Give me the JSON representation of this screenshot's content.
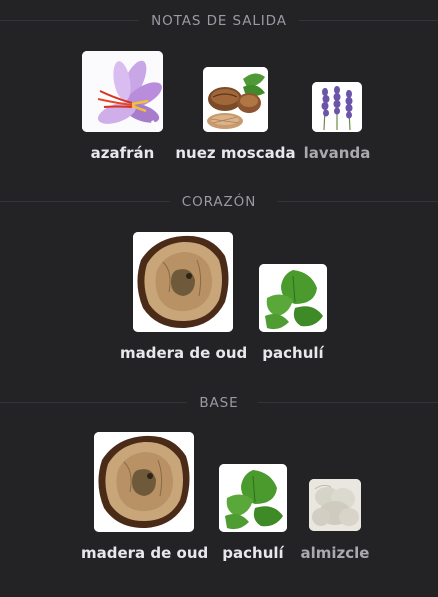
{
  "sections": [
    {
      "title": "NOTAS DE SALIDA",
      "notes": [
        {
          "label": "azafrán",
          "icon": "saffron-flower-icon",
          "emphasis": "high"
        },
        {
          "label": "nuez moscada",
          "icon": "nutmeg-icon",
          "emphasis": "medium"
        },
        {
          "label": "lavanda",
          "icon": "lavender-icon",
          "emphasis": "low"
        }
      ]
    },
    {
      "title": "CORAZÓN",
      "notes": [
        {
          "label": "madera de oud",
          "icon": "oud-wood-icon",
          "emphasis": "high"
        },
        {
          "label": "pachulí",
          "icon": "patchouli-leaf-icon",
          "emphasis": "medium"
        }
      ]
    },
    {
      "title": "BASE",
      "notes": [
        {
          "label": "madera de oud",
          "icon": "oud-wood-icon",
          "emphasis": "high"
        },
        {
          "label": "pachulí",
          "icon": "patchouli-leaf-icon",
          "emphasis": "medium"
        },
        {
          "label": "almizcle",
          "icon": "musk-icon",
          "emphasis": "low"
        }
      ]
    }
  ],
  "colors": {
    "background": "#232225",
    "header_text": "#9a9aa2",
    "label_text": "#e8e8ec",
    "label_dim_text": "#a9a9af"
  }
}
